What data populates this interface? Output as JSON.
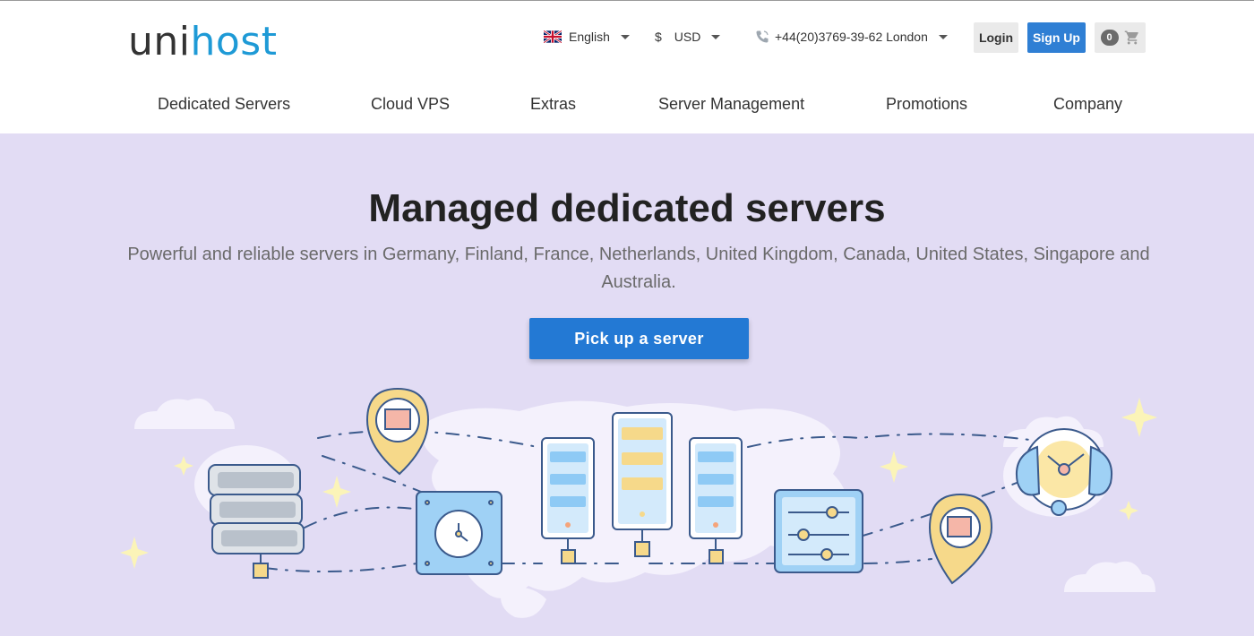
{
  "brand": {
    "part1": "uni",
    "part2": "host"
  },
  "topbar": {
    "language": "English",
    "currency_symbol": "$",
    "currency": "USD",
    "phone": "+44(20)3769-39-62 London",
    "login": "Login",
    "signup": "Sign Up",
    "cart_count": "0"
  },
  "nav": [
    "Dedicated Servers",
    "Cloud VPS",
    "Extras",
    "Server Management",
    "Promotions",
    "Company"
  ],
  "hero": {
    "title": "Managed dedicated servers",
    "subtitle": "Powerful and reliable servers in Germany, Finland, France, Netherlands, United Kingdom, Canada, United States, Singapore and Australia.",
    "cta": "Pick up a server"
  },
  "colors": {
    "brand_blue": "#1e9ad6",
    "button_blue": "#2379d4",
    "hero_bg": "#e2dcf4"
  },
  "icons": [
    "uk-flag-icon",
    "phone-icon",
    "cart-icon",
    "chevron-down-icon"
  ]
}
